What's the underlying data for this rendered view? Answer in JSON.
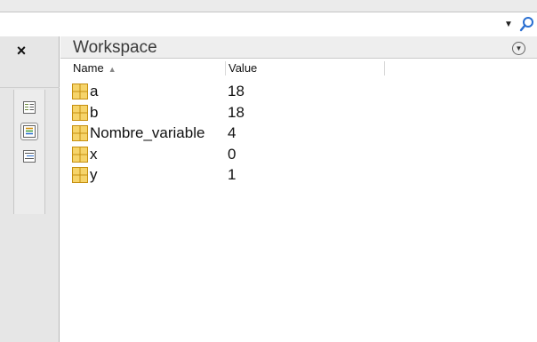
{
  "search": {
    "value": "",
    "placeholder": "",
    "icons": {
      "dropdown": "triangle-down-icon",
      "search": "magnifier-icon"
    }
  },
  "left_strip": {
    "close_label": "×",
    "tools": [
      "list-view-icon",
      "workspace-view-icon",
      "details-view-icon"
    ]
  },
  "workspace": {
    "title": "Workspace",
    "menu_icon": "panel-options-icon",
    "columns": {
      "name": "Name",
      "value": "Value",
      "sort_indicator": "▲"
    },
    "rows": [
      {
        "name": "a",
        "value": "18"
      },
      {
        "name": "b",
        "value": "18"
      },
      {
        "name": "Nombre_variable",
        "value": "4"
      },
      {
        "name": "x",
        "value": "0"
      },
      {
        "name": "y",
        "value": "1"
      }
    ]
  },
  "colors": {
    "accent": "#2a6fd1",
    "variable_icon_fill": "#f6d46a",
    "variable_icon_border": "#c58f10"
  }
}
